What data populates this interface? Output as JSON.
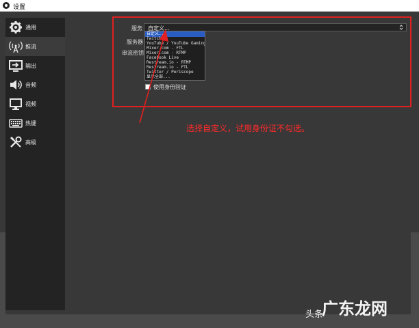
{
  "window": {
    "title": "设置"
  },
  "sidebar": {
    "items": [
      {
        "label": "通用",
        "icon": "gear-icon"
      },
      {
        "label": "推流",
        "icon": "broadcast-icon",
        "active": true
      },
      {
        "label": "输出",
        "icon": "output-icon"
      },
      {
        "label": "音频",
        "icon": "speaker-icon"
      },
      {
        "label": "视频",
        "icon": "monitor-icon"
      },
      {
        "label": "热键",
        "icon": "keyboard-icon"
      },
      {
        "label": "高级",
        "icon": "tools-icon"
      }
    ]
  },
  "form": {
    "service_label": "服务",
    "server_label": "服务器",
    "stream_key_label": "串流密钥",
    "service_value": "自定义...",
    "use_auth_label": "使用身份验证"
  },
  "dropdown": {
    "options": [
      "自定义...",
      "Twitch",
      "YouTube / YouTube Gaming",
      "Mixer.com - FTL",
      "Mixer.com - RTMP",
      "Facebook Live",
      "Restream.io - RTMP",
      "Restream.io - FTL",
      "Twitter / Periscope",
      "显示全部..."
    ],
    "selected_index": 0
  },
  "annotation": {
    "text": "选择自定义，试用身份证不勾选。",
    "color": "#ff2a2a"
  },
  "watermark": {
    "text1": "头条",
    "text2": "广东龙网"
  },
  "colors": {
    "accent": "#2a5dc4",
    "highlight": "#e02020"
  }
}
